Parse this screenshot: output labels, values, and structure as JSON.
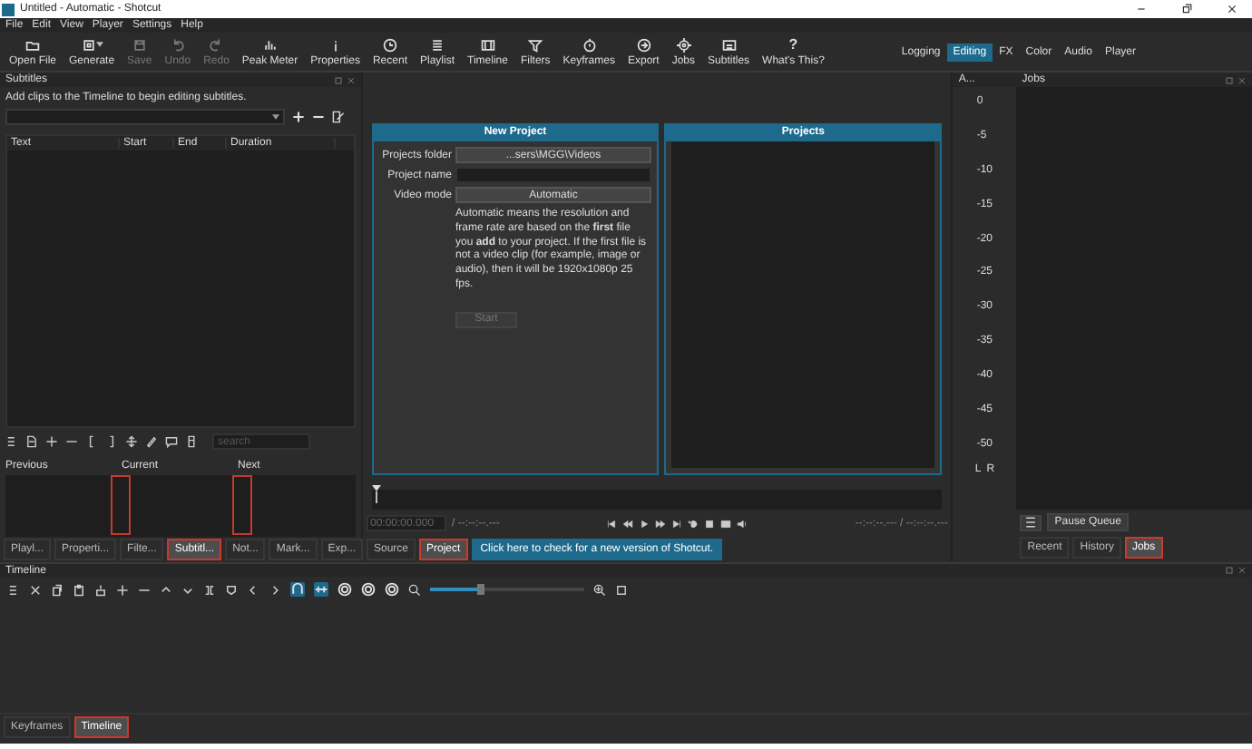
{
  "window": {
    "title": "Untitled - Automatic - Shotcut"
  },
  "menu": [
    "File",
    "Edit",
    "View",
    "Player",
    "Settings",
    "Help"
  ],
  "toolbar": [
    {
      "label": "Open File",
      "disabled": false
    },
    {
      "label": "Generate",
      "disabled": false,
      "dropdown": true
    },
    {
      "label": "Save",
      "disabled": true
    },
    {
      "label": "Undo",
      "disabled": true
    },
    {
      "label": "Redo",
      "disabled": true
    },
    {
      "label": "Peak Meter",
      "disabled": false
    },
    {
      "label": "Properties",
      "disabled": false
    },
    {
      "label": "Recent",
      "disabled": false
    },
    {
      "label": "Playlist",
      "disabled": false
    },
    {
      "label": "Timeline",
      "disabled": false
    },
    {
      "label": "Filters",
      "disabled": false
    },
    {
      "label": "Keyframes",
      "disabled": false
    },
    {
      "label": "Export",
      "disabled": false
    },
    {
      "label": "Jobs",
      "disabled": false
    },
    {
      "label": "Subtitles",
      "disabled": false
    },
    {
      "label": "What's This?",
      "disabled": false,
      "glyph": "?"
    }
  ],
  "layouts": [
    {
      "label": "Logging",
      "selected": false
    },
    {
      "label": "Editing",
      "selected": true
    },
    {
      "label": "FX",
      "selected": false
    },
    {
      "label": "Color",
      "selected": false
    },
    {
      "label": "Audio",
      "selected": false
    },
    {
      "label": "Player",
      "selected": false
    }
  ],
  "subtitles": {
    "title": "Subtitles",
    "hint": "Add clips to the Timeline to begin editing subtitles.",
    "columns": [
      "Text",
      "Start",
      "End",
      "Duration"
    ],
    "search": {
      "placeholder": "search"
    },
    "preview": [
      "Previous",
      "Current",
      "Next"
    ],
    "boundary_marks": true
  },
  "left_tabs": [
    {
      "label": "Playl...",
      "selected": false,
      "highlighted": false
    },
    {
      "label": "Properti...",
      "selected": false,
      "highlighted": false
    },
    {
      "label": "Filte...",
      "selected": false,
      "highlighted": false
    },
    {
      "label": "Subtitl...",
      "selected": true,
      "highlighted": true
    },
    {
      "label": "Not...",
      "selected": false,
      "highlighted": false
    },
    {
      "label": "Mark...",
      "selected": false,
      "highlighted": false
    },
    {
      "label": "Exp...",
      "selected": false,
      "highlighted": false
    }
  ],
  "new_project": {
    "title": "New Project",
    "fields": [
      {
        "label": "Projects folder",
        "kind": "button",
        "value": "...sers\\MGG\\Videos"
      },
      {
        "label": "Project name",
        "kind": "input"
      },
      {
        "label": "Video mode",
        "kind": "button",
        "value": "Automatic"
      }
    ],
    "note": "Automatic means the resolution and frame rate are based on the **first** file you **add** to your project. If the first file is not a video clip (for example, image or audio), then it will be 1920x1080p 25 fps.",
    "start": {
      "label": "Start",
      "disabled": true
    }
  },
  "projects": {
    "title": "Projects"
  },
  "player": {
    "timecode": "00:00:00.000",
    "duration": "/ --:--:--.---",
    "in_out": "--:--:--.--- / --:--:--.---"
  },
  "center_tabs": [
    {
      "label": "Source",
      "selected": false,
      "highlighted": false
    },
    {
      "label": "Project",
      "selected": true,
      "highlighted": true
    }
  ],
  "update_notice": "Click here to check for a new version of Shotcut.",
  "audio_meter": {
    "title": "A...",
    "scale": [
      "0",
      "-5",
      "-10",
      "-15",
      "-20",
      "-25",
      "-30",
      "-35",
      "-40",
      "-45",
      "-50"
    ],
    "channels": [
      "L",
      "R"
    ]
  },
  "jobs": {
    "title": "Jobs",
    "pause": "Pause Queue",
    "tabs": [
      {
        "label": "Recent",
        "selected": false,
        "highlighted": false
      },
      {
        "label": "History",
        "selected": false,
        "highlighted": false
      },
      {
        "label": "Jobs",
        "selected": true,
        "highlighted": true
      }
    ]
  },
  "timeline": {
    "title": "Timeline",
    "toggles": [
      {
        "on": true
      },
      {
        "on": true
      },
      {
        "on": false
      },
      {
        "on": false
      },
      {
        "on": false
      }
    ],
    "tabs": [
      {
        "label": "Keyframes",
        "selected": false,
        "highlighted": false
      },
      {
        "label": "Timeline",
        "selected": true,
        "highlighted": true
      }
    ]
  }
}
